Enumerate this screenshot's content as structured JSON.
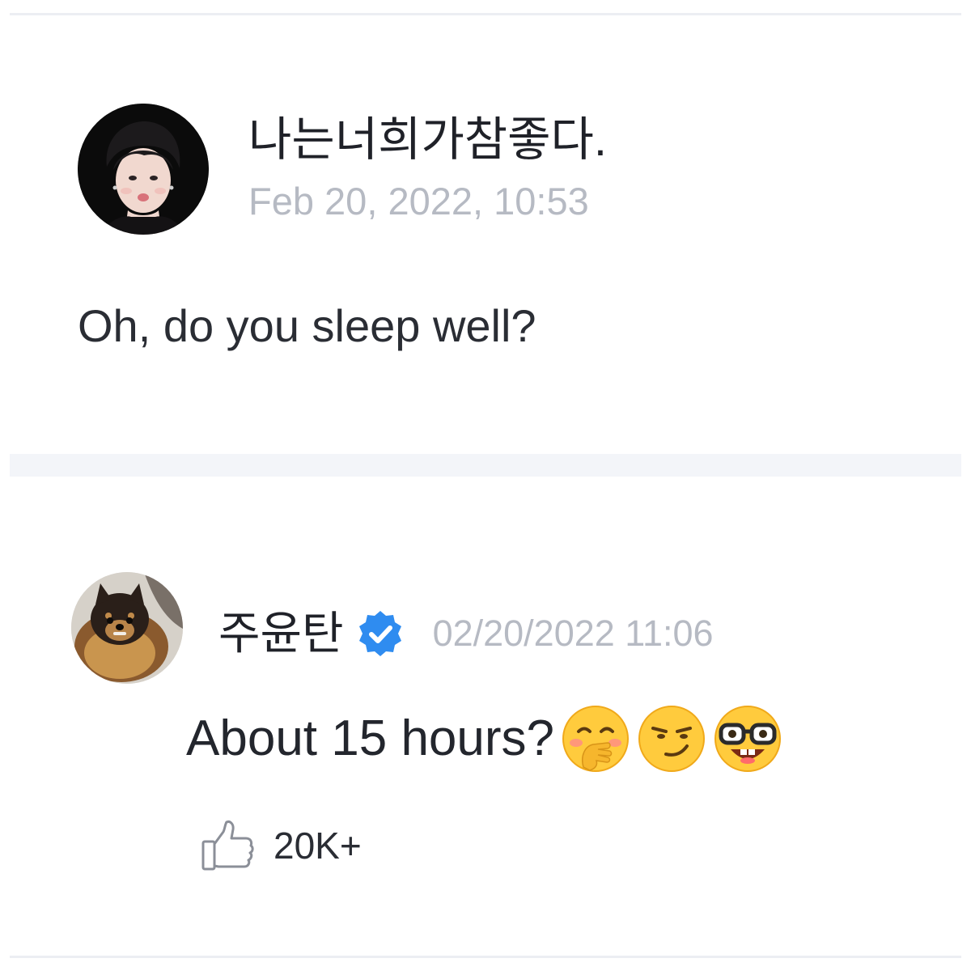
{
  "post": {
    "author": "나는너희가참좋다.",
    "date": "Feb 20, 2022, 10:53",
    "body": "Oh, do you sleep well?",
    "avatar_icon": "person-portrait-avatar"
  },
  "comment": {
    "author": "주윤탄",
    "verified_icon": "verified-badge-icon",
    "timestamp": "02/20/2022 11:06",
    "text": "About 15 hours?",
    "emojis": [
      "hand-over-mouth-emoji",
      "smirking-face-emoji",
      "nerd-face-emoji"
    ],
    "avatar_icon": "dog-avatar",
    "likes": "20K+",
    "like_icon": "thumbs-up-icon"
  },
  "colors": {
    "text_primary": "#1f2128",
    "text_muted": "#b6bac3",
    "verified_blue": "#2f8cf0",
    "divider": "#eceef3",
    "section_gap": "#f3f5f9"
  }
}
